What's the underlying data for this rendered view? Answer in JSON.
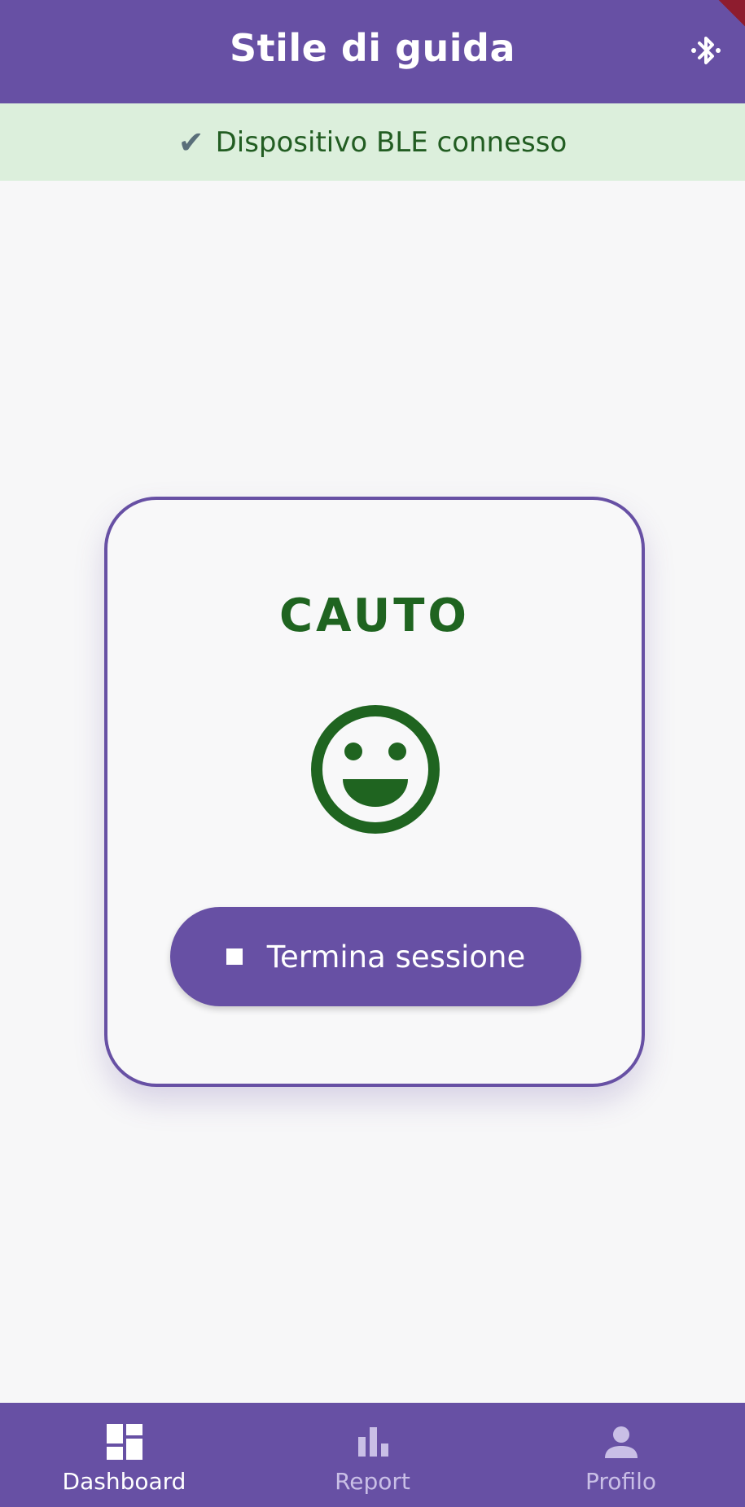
{
  "appbar": {
    "title": "Stile di guida",
    "bluetooth_icon": "bluetooth-searching-icon"
  },
  "status": {
    "check_glyph": "✔",
    "text": "Dispositivo BLE connesso"
  },
  "card": {
    "mode": "CAUTO",
    "mood_icon": "smiley-face-icon",
    "end_button_label": "Termina sessione",
    "end_button_icon": "stop-icon"
  },
  "bottom_nav": {
    "items": [
      {
        "label": "Dashboard",
        "icon": "dashboard-icon",
        "active": true
      },
      {
        "label": "Report",
        "icon": "bar-chart-icon",
        "active": false
      },
      {
        "label": "Profilo",
        "icon": "person-icon",
        "active": false
      }
    ]
  },
  "colors": {
    "primary": "#6750a4",
    "status_bg": "#dcefdc",
    "positive_green": "#1f6420"
  }
}
